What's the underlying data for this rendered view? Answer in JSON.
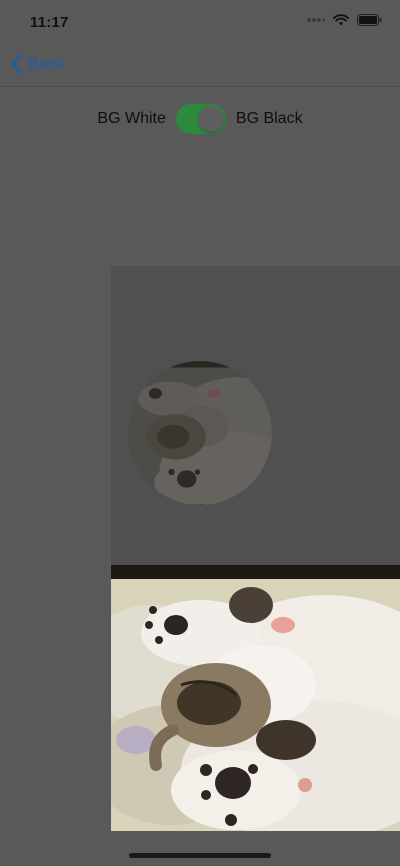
{
  "status_bar": {
    "time": "11:17",
    "icons": [
      "signal-dots-icon",
      "wifi-icon",
      "battery-icon"
    ]
  },
  "nav": {
    "back_label": "Back",
    "back_icon": "chevron-left-icon"
  },
  "toggle": {
    "left_label": "BG White",
    "right_label": "BG Black",
    "is_on": true
  },
  "images": {
    "circle_photo": "sleeping-kitten-photo",
    "rect_photo": "sleeping-kitten-photo"
  },
  "colors": {
    "accent": "#1e5ea8",
    "switch_on": "#2b8a3e",
    "background_dimmed": "#595959",
    "panel": "#505050"
  }
}
